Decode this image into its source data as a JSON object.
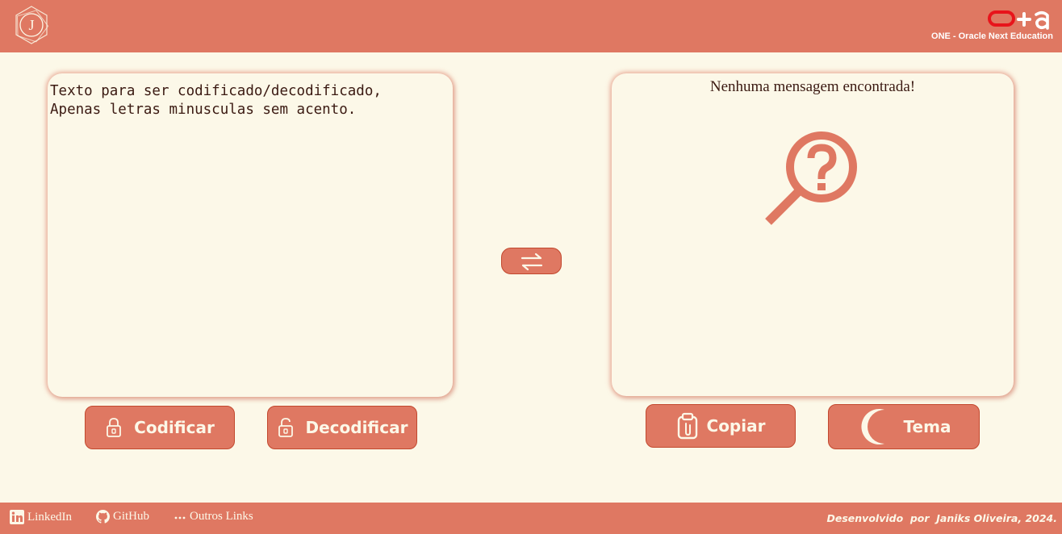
{
  "colors": {
    "primary": "#df7862",
    "background": "#fcf8e8",
    "text": "#3b1a12",
    "oracle_red": "#e8141b"
  },
  "header": {
    "logo_letter": "J",
    "oracle_caption": "ONE - Oracle Next Education"
  },
  "input": {
    "text": "Texto para ser codificado/decodificado,\nApenas letras minusculas sem acento."
  },
  "output": {
    "empty_message": "Nenhuma mensagem encontrada!",
    "empty_icon": "search-question-icon"
  },
  "buttons": {
    "encode_label": "Codificar",
    "encode_icon": "lock-icon",
    "decode_label": "Decodificar",
    "decode_icon": "unlock-icon",
    "swap_icon": "swap-arrows-icon",
    "copy_label": "Copiar",
    "copy_icon": "clipboard-icon",
    "theme_label": "Tema",
    "theme_icon": "moon-icon"
  },
  "footer": {
    "links": [
      {
        "label": "LinkedIn",
        "icon": "linkedin-icon"
      },
      {
        "label": "GitHub",
        "icon": "github-icon"
      },
      {
        "label": "Outros Links",
        "icon": "dots-icon"
      }
    ],
    "credits": "Desenvolvido  por  Janiks Oliveira, 2024."
  }
}
